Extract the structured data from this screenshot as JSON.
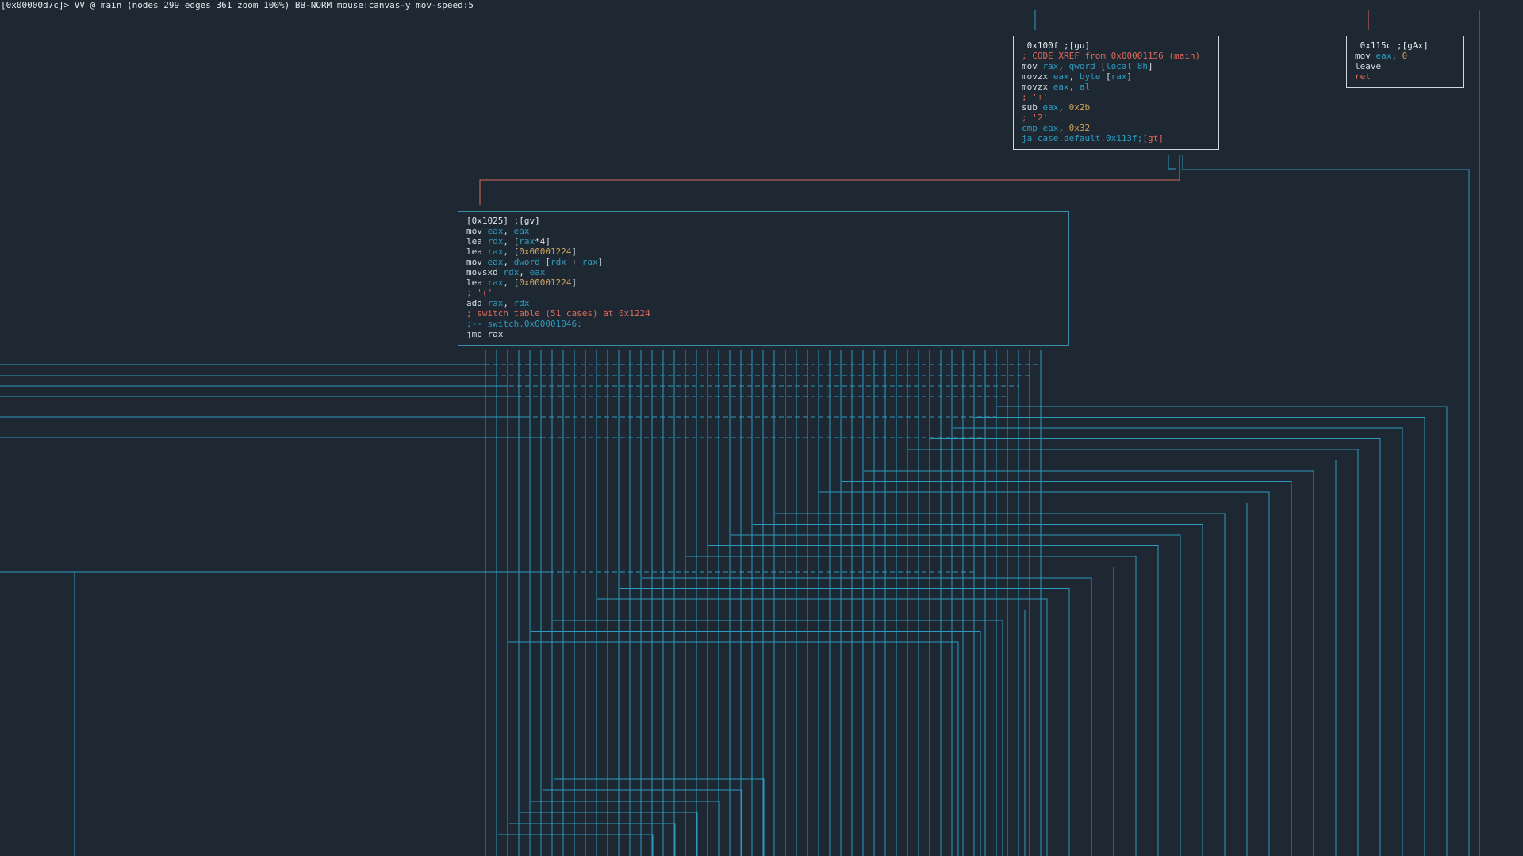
{
  "status": {
    "text": "[0x00000d7c]> VV @ main (nodes 299 edges 361 zoom 100%) BB-NORM mouse:canvas-y mov-speed:5"
  },
  "colors": {
    "background": "#1d2833",
    "edge_true": "#2d9cbf",
    "edge_false": "#e0685a",
    "border": "#cfd6dd",
    "border_current": "#3a8fa8"
  },
  "nodes": {
    "node_100f": {
      "lines": [
        [
          {
            "t": " 0x100f ;[gu]",
            "c": "title"
          }
        ],
        [
          {
            "t": "; CODE XREF from 0x00001156 (main)",
            "c": "comment"
          }
        ],
        [
          {
            "t": "mov ",
            "c": "op"
          },
          {
            "t": "rax",
            "c": "reg"
          },
          {
            "t": ", ",
            "c": "punct"
          },
          {
            "t": "qword",
            "c": "reg"
          },
          {
            "t": " [",
            "c": "punct"
          },
          {
            "t": "local_8h",
            "c": "reg"
          },
          {
            "t": "]",
            "c": "punct"
          }
        ],
        [
          {
            "t": "movzx ",
            "c": "op"
          },
          {
            "t": "eax",
            "c": "reg"
          },
          {
            "t": ", ",
            "c": "punct"
          },
          {
            "t": "byte",
            "c": "reg"
          },
          {
            "t": " [",
            "c": "punct"
          },
          {
            "t": "rax",
            "c": "reg"
          },
          {
            "t": "]",
            "c": "punct"
          }
        ],
        [
          {
            "t": "movzx ",
            "c": "op"
          },
          {
            "t": "eax",
            "c": "reg"
          },
          {
            "t": ", ",
            "c": "punct"
          },
          {
            "t": "al",
            "c": "reg"
          }
        ],
        [
          {
            "t": "; '+'",
            "c": "comment"
          }
        ],
        [
          {
            "t": "sub ",
            "c": "op"
          },
          {
            "t": "eax",
            "c": "reg"
          },
          {
            "t": ", ",
            "c": "punct"
          },
          {
            "t": "0x2b",
            "c": "num"
          }
        ],
        [
          {
            "t": "; '2'",
            "c": "comment"
          }
        ],
        [
          {
            "t": "cmp ",
            "c": "cmp"
          },
          {
            "t": "eax",
            "c": "reg"
          },
          {
            "t": ", ",
            "c": "punct"
          },
          {
            "t": "0x32",
            "c": "num"
          }
        ],
        [
          {
            "t": "ja case.default.0x113f;",
            "c": "flag"
          },
          {
            "t": "[gt]",
            "c": "comment"
          }
        ]
      ]
    },
    "node_115c": {
      "lines": [
        [
          {
            "t": " 0x115c ;[gAx]",
            "c": "title"
          }
        ],
        [
          {
            "t": "mov ",
            "c": "op"
          },
          {
            "t": "eax",
            "c": "reg"
          },
          {
            "t": ", ",
            "c": "punct"
          },
          {
            "t": "0",
            "c": "num"
          }
        ],
        [
          {
            "t": "leave",
            "c": "op"
          }
        ],
        [
          {
            "t": "ret",
            "c": "ret"
          }
        ]
      ]
    },
    "node_1025": {
      "lines": [
        [
          {
            "t": "[0x1025] ;[gv]",
            "c": "title"
          }
        ],
        [
          {
            "t": "mov ",
            "c": "op"
          },
          {
            "t": "eax",
            "c": "reg"
          },
          {
            "t": ", ",
            "c": "punct"
          },
          {
            "t": "eax",
            "c": "reg"
          }
        ],
        [
          {
            "t": "lea ",
            "c": "op"
          },
          {
            "t": "rdx",
            "c": "reg"
          },
          {
            "t": ", [",
            "c": "punct"
          },
          {
            "t": "rax",
            "c": "reg"
          },
          {
            "t": "*4]",
            "c": "punct"
          }
        ],
        [
          {
            "t": "lea ",
            "c": "op"
          },
          {
            "t": "rax",
            "c": "reg"
          },
          {
            "t": ", [",
            "c": "punct"
          },
          {
            "t": "0x00001224",
            "c": "num"
          },
          {
            "t": "]",
            "c": "punct"
          }
        ],
        [
          {
            "t": "mov ",
            "c": "op"
          },
          {
            "t": "eax",
            "c": "reg"
          },
          {
            "t": ", ",
            "c": "punct"
          },
          {
            "t": "dword",
            "c": "reg"
          },
          {
            "t": " [",
            "c": "punct"
          },
          {
            "t": "rdx",
            "c": "reg"
          },
          {
            "t": " + ",
            "c": "punct"
          },
          {
            "t": "rax",
            "c": "reg"
          },
          {
            "t": "]",
            "c": "punct"
          }
        ],
        [
          {
            "t": "movsxd ",
            "c": "op"
          },
          {
            "t": "rdx",
            "c": "reg"
          },
          {
            "t": ", ",
            "c": "punct"
          },
          {
            "t": "eax",
            "c": "reg"
          }
        ],
        [
          {
            "t": "lea ",
            "c": "op"
          },
          {
            "t": "rax",
            "c": "reg"
          },
          {
            "t": ", [",
            "c": "punct"
          },
          {
            "t": "0x00001224",
            "c": "num"
          },
          {
            "t": "]",
            "c": "punct"
          }
        ],
        [
          {
            "t": "; '('",
            "c": "comment"
          }
        ],
        [
          {
            "t": "add ",
            "c": "op"
          },
          {
            "t": "rax",
            "c": "reg"
          },
          {
            "t": ", ",
            "c": "punct"
          },
          {
            "t": "rdx",
            "c": "reg"
          }
        ],
        [
          {
            "t": "; switch table (51 cases) at 0x1224",
            "c": "comment"
          }
        ],
        [
          {
            "t": ";-- switch.0x00001046:",
            "c": "flag"
          }
        ],
        [
          {
            "t": "jmp rax",
            "c": "op"
          }
        ]
      ]
    }
  }
}
